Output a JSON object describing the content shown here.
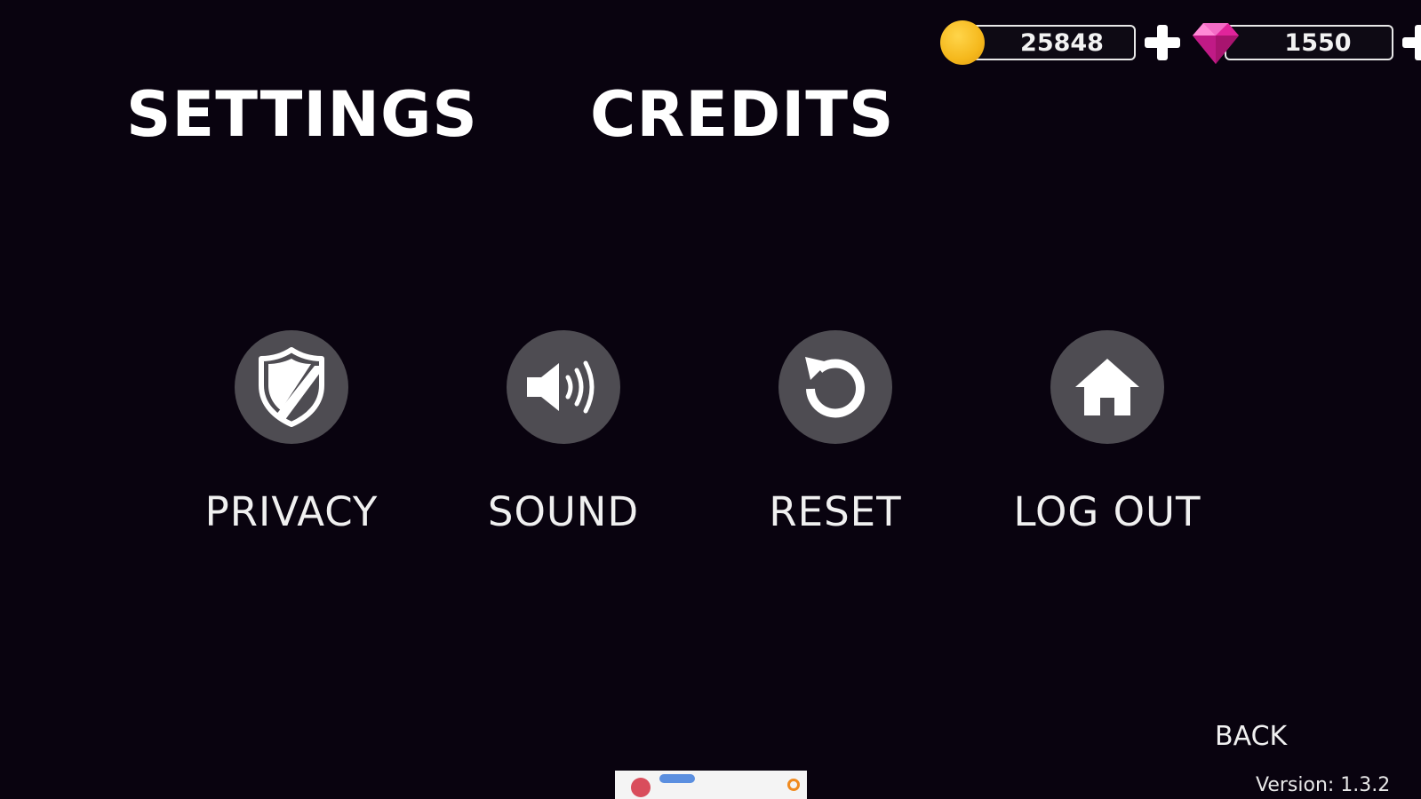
{
  "currency": {
    "coins": {
      "value": "25848",
      "icon": "coin-icon",
      "color": "#f5b81c"
    },
    "gems": {
      "value": "1550",
      "icon": "gem-icon",
      "color": "#e0249b"
    }
  },
  "tabs": {
    "settings": "SETTINGS",
    "credits": "CREDITS"
  },
  "options": {
    "privacy": {
      "label": "PRIVACY",
      "icon": "shield-icon"
    },
    "sound": {
      "label": "SOUND",
      "icon": "speaker-icon"
    },
    "reset": {
      "label": "RESET",
      "icon": "reset-icon"
    },
    "logout": {
      "label": "LOG OUT",
      "icon": "home-icon"
    }
  },
  "footer": {
    "back_label": "BACK",
    "version": "Version: 1.3.2"
  },
  "colors": {
    "background": "#09030f",
    "button_circle": "#4e4c52",
    "text": "#ffffff"
  }
}
